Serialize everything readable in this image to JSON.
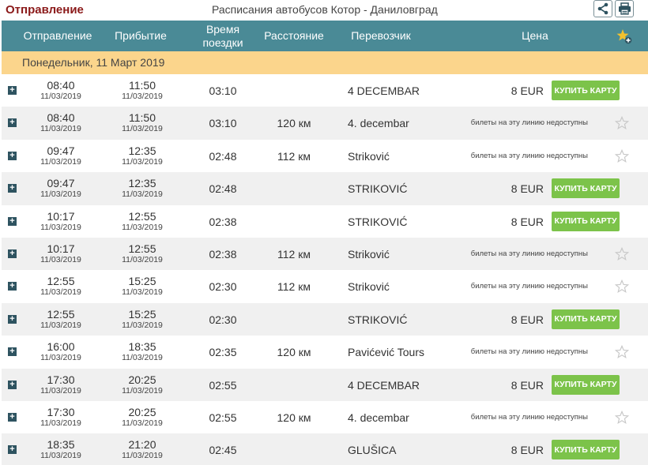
{
  "header": {
    "brand": "Отправление",
    "title": "Расписания автобусов Котор - Даниловград"
  },
  "columns": {
    "departure": "Отправление",
    "arrival": "Прибытие",
    "duration_line1": "Время",
    "duration_line2": "поездки",
    "distance": "Расстояние",
    "carrier": "Перевозчик",
    "price": "Цена"
  },
  "date_band": "Понедельник, 11 Март 2019",
  "buy_label": "КУПИТЬ КАРТУ",
  "unavailable_text": "билеты на эту линию недоступны",
  "icons": {
    "share": "share-icon",
    "print": "printer-icon",
    "favorites_header": "star-plus-icon",
    "row_favorite": "star-outline-icon",
    "expand": "plus-square-icon"
  },
  "colors": {
    "brand": "#8b1a1a",
    "header_bg": "#4a8a96",
    "date_band_bg": "#fbd58c",
    "buy_button": "#7cc34a",
    "alt_row": "#f0f0f0"
  },
  "trips": [
    {
      "dep": "08:40",
      "dep_date": "11/03/2019",
      "arr": "11:50",
      "arr_date": "11/03/2019",
      "duration": "03:10",
      "distance": "",
      "carrier": "4 DECEMBAR",
      "price": "8  EUR",
      "available": true
    },
    {
      "dep": "08:40",
      "dep_date": "11/03/2019",
      "arr": "11:50",
      "arr_date": "11/03/2019",
      "duration": "03:10",
      "distance": "120 км",
      "carrier": "4. decembar",
      "price": "",
      "available": false
    },
    {
      "dep": "09:47",
      "dep_date": "11/03/2019",
      "arr": "12:35",
      "arr_date": "11/03/2019",
      "duration": "02:48",
      "distance": "112 км",
      "carrier": "Striković",
      "price": "",
      "available": false
    },
    {
      "dep": "09:47",
      "dep_date": "11/03/2019",
      "arr": "12:35",
      "arr_date": "11/03/2019",
      "duration": "02:48",
      "distance": "",
      "carrier": "STRIKOVIĆ",
      "price": "8  EUR",
      "available": true
    },
    {
      "dep": "10:17",
      "dep_date": "11/03/2019",
      "arr": "12:55",
      "arr_date": "11/03/2019",
      "duration": "02:38",
      "distance": "",
      "carrier": "STRIKOVIĆ",
      "price": "8  EUR",
      "available": true
    },
    {
      "dep": "10:17",
      "dep_date": "11/03/2019",
      "arr": "12:55",
      "arr_date": "11/03/2019",
      "duration": "02:38",
      "distance": "112 км",
      "carrier": "Striković",
      "price": "",
      "available": false
    },
    {
      "dep": "12:55",
      "dep_date": "11/03/2019",
      "arr": "15:25",
      "arr_date": "11/03/2019",
      "duration": "02:30",
      "distance": "112 км",
      "carrier": "Striković",
      "price": "",
      "available": false
    },
    {
      "dep": "12:55",
      "dep_date": "11/03/2019",
      "arr": "15:25",
      "arr_date": "11/03/2019",
      "duration": "02:30",
      "distance": "",
      "carrier": "STRIKOVIĆ",
      "price": "8  EUR",
      "available": true
    },
    {
      "dep": "16:00",
      "dep_date": "11/03/2019",
      "arr": "18:35",
      "arr_date": "11/03/2019",
      "duration": "02:35",
      "distance": "120 км",
      "carrier": "Pavićević Tours",
      "price": "",
      "available": false
    },
    {
      "dep": "17:30",
      "dep_date": "11/03/2019",
      "arr": "20:25",
      "arr_date": "11/03/2019",
      "duration": "02:55",
      "distance": "",
      "carrier": "4 DECEMBAR",
      "price": "8  EUR",
      "available": true
    },
    {
      "dep": "17:30",
      "dep_date": "11/03/2019",
      "arr": "20:25",
      "arr_date": "11/03/2019",
      "duration": "02:55",
      "distance": "120 км",
      "carrier": "4. decembar",
      "price": "",
      "available": false
    },
    {
      "dep": "18:35",
      "dep_date": "11/03/2019",
      "arr": "21:20",
      "arr_date": "11/03/2019",
      "duration": "02:45",
      "distance": "",
      "carrier": "GLUŠICA",
      "price": "8  EUR",
      "available": true
    }
  ]
}
